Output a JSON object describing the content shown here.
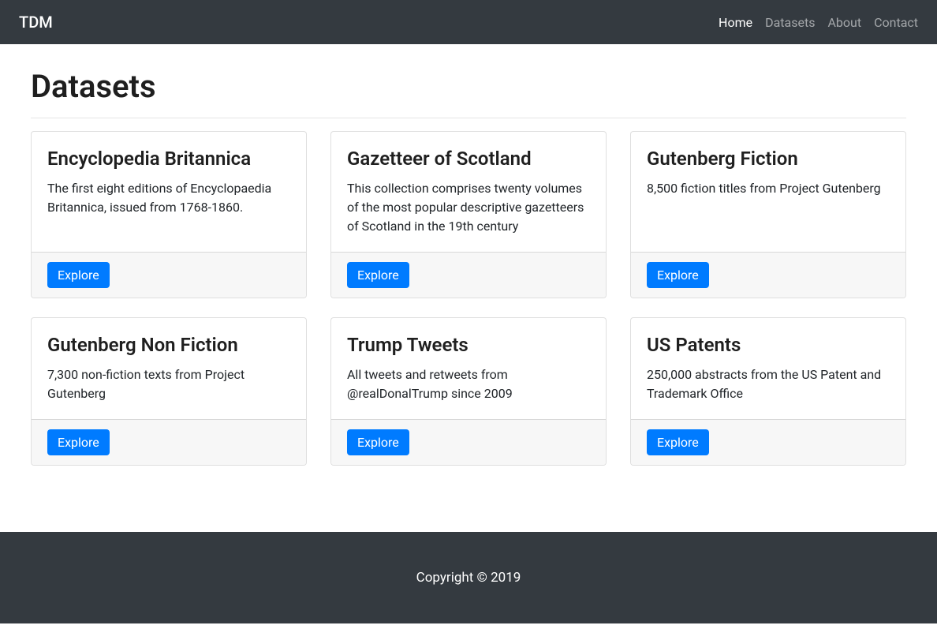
{
  "brand": "TDM",
  "nav": {
    "items": [
      {
        "label": "Home",
        "active": true
      },
      {
        "label": "Datasets",
        "active": false
      },
      {
        "label": "About",
        "active": false
      },
      {
        "label": "Contact",
        "active": false
      }
    ]
  },
  "page": {
    "title": "Datasets"
  },
  "datasets": [
    {
      "title": "Encyclopedia Britannica",
      "description": "The first eight editions of Encyclopaedia Britannica, issued from 1768-1860.",
      "button": "Explore"
    },
    {
      "title": "Gazetteer of Scotland",
      "description": "This collection comprises twenty volumes of the most popular descriptive gazetteers of Scotland in the 19th century",
      "button": "Explore"
    },
    {
      "title": "Gutenberg Fiction",
      "description": "8,500 fiction titles from Project Gutenberg",
      "button": "Explore"
    },
    {
      "title": "Gutenberg Non Fiction",
      "description": "7,300 non-fiction texts from Project Gutenberg",
      "button": "Explore"
    },
    {
      "title": "Trump Tweets",
      "description": "All tweets and retweets from @realDonalTrump since 2009",
      "button": "Explore"
    },
    {
      "title": "US Patents",
      "description": "250,000 abstracts from the US Patent and Trademark Office",
      "button": "Explore"
    }
  ],
  "footer": {
    "text": "Copyright © 2019"
  }
}
